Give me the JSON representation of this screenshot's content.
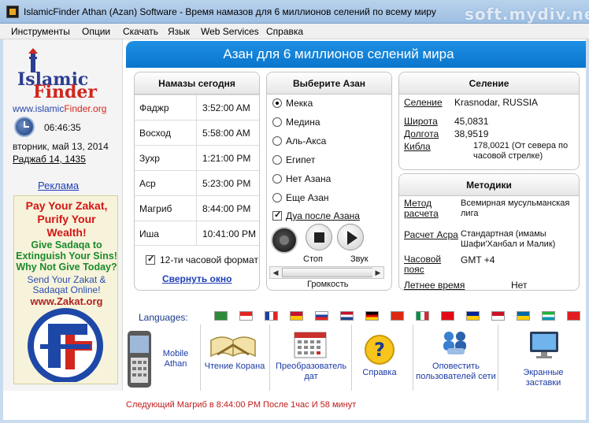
{
  "window": {
    "title": "IslamicFinder Athan (Azan) Software - Время намазов для 6 миллионов селений по всему миру",
    "watermark": "soft.mydiv.net"
  },
  "menu": [
    "Инструменты",
    "Опции",
    "Скачать",
    "Язык",
    "Web Services",
    "Справка"
  ],
  "sidebar": {
    "logo_islamic": "Islamic",
    "logo_finder": "Finder",
    "url_prefix": "www.islamic",
    "url_suffix": "Finder.org",
    "clock": "06:46:35",
    "date": "вторник, май 13, 2014",
    "hijri": "Раджаб 14, 1435",
    "ads_link": "Реклама",
    "zakat": {
      "line1": "Pay Your Zakat,",
      "line2": "Purify Your",
      "line3": "Wealth!",
      "line4": "Give Sadaqa to",
      "line5": "Extinguish Your Sins!",
      "line6": "Why Not Give Today?",
      "line7": "Send Your Zakat &",
      "line8": "Sadaqat Online!",
      "line9": "www.Zakat.org"
    }
  },
  "banner": "Азан для 6 миллионов селений мира",
  "prayers_panel": {
    "title": "Намазы сегодня",
    "rows": [
      {
        "name": "Фаджр",
        "time": "3:52:00 AM"
      },
      {
        "name": "Восход",
        "time": "5:58:00 AM"
      },
      {
        "name": "Зухр",
        "time": "1:21:00 PM"
      },
      {
        "name": "Аср",
        "time": "5:23:00 PM"
      },
      {
        "name": "Магриб",
        "time": "8:44:00 PM"
      },
      {
        "name": "Иша",
        "time": "10:41:00 PM"
      }
    ],
    "format_checkbox": "12-ти часовой формат",
    "collapse_link": "Свернуть окно"
  },
  "azan_panel": {
    "title": "Выберите Азан",
    "options": [
      "Мекка",
      "Медина",
      "Аль-Акса",
      "Египет",
      "Нет Азана",
      "Еще Азан"
    ],
    "selected": "Мекка",
    "dua_checkbox": "Дуа после Азана",
    "stop_label": "Стоп",
    "sound_label": "Звук",
    "volume_label": "Громкость"
  },
  "location_panel": {
    "title": "Селение",
    "rows": [
      {
        "key": "Селение",
        "value": "Krasnodar, RUSSIA"
      },
      {
        "key": "Широта",
        "value": "45,0831"
      },
      {
        "key": "Долгота",
        "value": "38,9519"
      },
      {
        "key": "Кибла",
        "value": "178,0021 (От севера по часовой стрелке)"
      }
    ]
  },
  "methods_panel": {
    "title": "Методики",
    "rows": [
      {
        "key": "Метод расчета",
        "value": "Всемирная мусульманская лига"
      },
      {
        "key": "Расчет Асра",
        "value": "Стандартная (имамы Шафи'Ханбал и Малик)"
      },
      {
        "key": "Часовой пояс",
        "value": "GMT +4"
      },
      {
        "key": "Летнее время",
        "value": "Нет"
      }
    ]
  },
  "languages": {
    "label": "Languages:",
    "flags": [
      {
        "name": "arabic",
        "colors": [
          "#2c8a3a",
          "#2c8a3a"
        ]
      },
      {
        "name": "canada",
        "colors": [
          "#e52521",
          "#ffffff"
        ]
      },
      {
        "name": "france",
        "colors": [
          "#1e3fa0",
          "#ffffff",
          "#e52521"
        ]
      },
      {
        "name": "spain",
        "colors": [
          "#c8102e",
          "#ffc400"
        ]
      },
      {
        "name": "russia",
        "colors": [
          "#ffffff",
          "#1e3fa0",
          "#e52521"
        ]
      },
      {
        "name": "netherlands",
        "colors": [
          "#c8102e",
          "#ffffff",
          "#21468b"
        ]
      },
      {
        "name": "germany",
        "colors": [
          "#000000",
          "#dd0000",
          "#ffce00"
        ]
      },
      {
        "name": "china",
        "colors": [
          "#de2910",
          "#de2910"
        ]
      },
      {
        "name": "italy",
        "colors": [
          "#009246",
          "#ffffff",
          "#ce2b37"
        ]
      },
      {
        "name": "turkey",
        "colors": [
          "#e30a17",
          "#e30a17"
        ]
      },
      {
        "name": "bosnia",
        "colors": [
          "#002395",
          "#fecb00"
        ]
      },
      {
        "name": "indonesia",
        "colors": [
          "#ce1126",
          "#ffffff"
        ]
      },
      {
        "name": "sweden",
        "colors": [
          "#006aa7",
          "#fecc00"
        ]
      },
      {
        "name": "uzbekistan",
        "colors": [
          "#1eb53a",
          "#ffffff",
          "#0099b5"
        ]
      },
      {
        "name": "albania",
        "colors": [
          "#e41e20",
          "#e41e20"
        ]
      }
    ]
  },
  "toolbar": {
    "mobile": "Mobile Athan",
    "quran": "Чтение Корана",
    "converter": "Преобразователь дат",
    "help": "Справка",
    "notify": "Оповестить пользователей сети",
    "screensaver": "Экранные заставки"
  },
  "status": "Следующий Магриб в 8:44:00 PM После 1час И 58 минут"
}
